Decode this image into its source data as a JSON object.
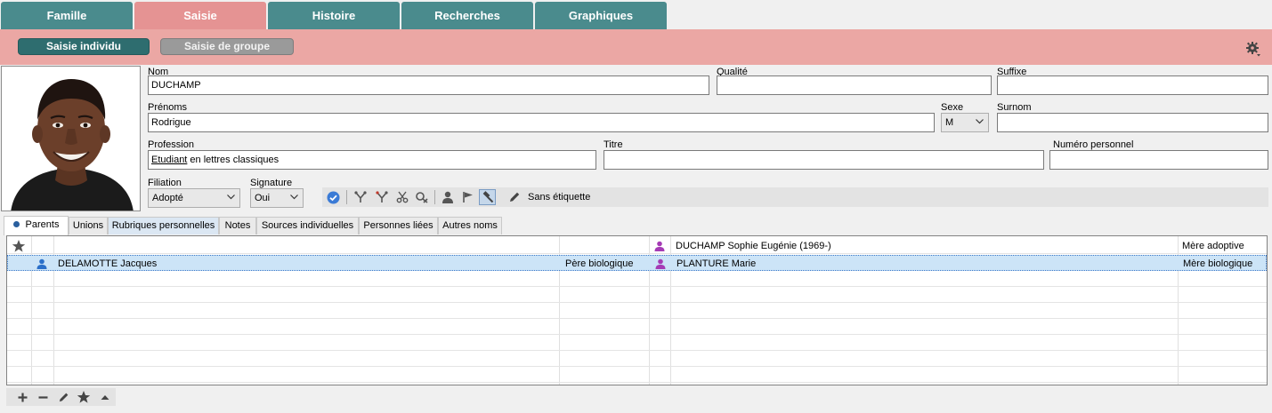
{
  "top_tabs": [
    "Famille",
    "Saisie",
    "Histoire",
    "Recherches",
    "Graphiques"
  ],
  "mode": {
    "individual": "Saisie individu",
    "group": "Saisie de groupe"
  },
  "form": {
    "nom_label": "Nom",
    "nom_value": "DUCHAMP",
    "qualite_label": "Qualité",
    "qualite_value": "",
    "suffixe_label": "Suffixe",
    "suffixe_value": "",
    "prenoms_label": "Prénoms",
    "prenoms_value": "Rodrigue",
    "sexe_label": "Sexe",
    "sexe_value": "M",
    "surnom_label": "Surnom",
    "surnom_value": "",
    "profession_label": "Profession",
    "profession_underlined": "Etudiant",
    "profession_rest": " en lettres classiques",
    "titre_label": "Titre",
    "titre_value": "",
    "numero_label": "Numéro personnel",
    "numero_value": "",
    "filiation_label": "Filiation",
    "filiation_value": "Adopté",
    "signature_label": "Signature",
    "signature_value": "Oui"
  },
  "toolbar": {
    "tag_label": "Sans étiquette"
  },
  "sub_tabs": [
    "Parents",
    "Unions",
    "Rubriques personnelles",
    "Notes",
    "Sources individuelles",
    "Personnes liées",
    "Autres noms"
  ],
  "parents_rows": [
    {
      "father_name": "",
      "father_role": "",
      "mother_name": "DUCHAMP Sophie Eugénie (1969-)",
      "mother_role": "Mère adoptive"
    },
    {
      "father_name": "DELAMOTTE Jacques",
      "father_role": "Père biologique",
      "mother_name": "PLANTURE Marie",
      "mother_role": "Mère biologique"
    }
  ],
  "colors": {
    "tab_teal": "#4a8b8d",
    "tab_active": "#e59393",
    "band_pink": "#eba7a4",
    "male_blue": "#2a6fc9",
    "female_purple": "#a53bb5"
  },
  "icons": [
    "gear-icon",
    "check-circle-icon",
    "branch-icon",
    "branch-red-icon",
    "scissors-icon",
    "unlink-icon",
    "person-icon",
    "flag-icon",
    "hammer-icon",
    "pencil-icon",
    "star-icon",
    "plus-icon",
    "minus-icon",
    "caret-up-icon"
  ]
}
